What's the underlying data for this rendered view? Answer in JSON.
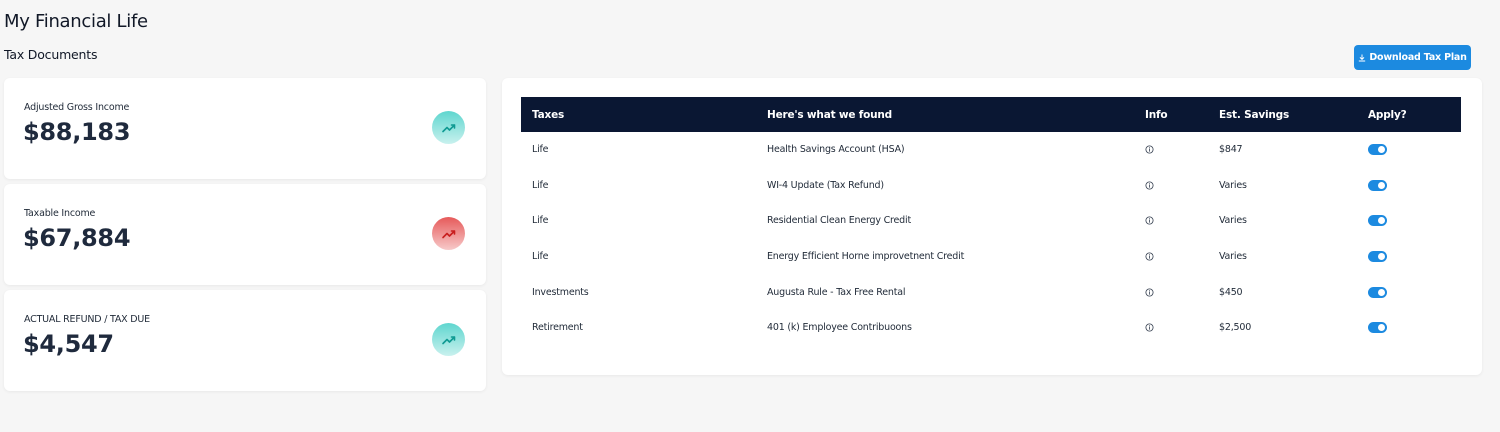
{
  "header": {
    "page_title": "My Financial Life",
    "section_title": "Tax Documents",
    "download_label": "Download Tax Plan"
  },
  "cards": [
    {
      "label": "Adjusted Gross Income",
      "value": "$88,183",
      "trend": "up",
      "icon": "trending-up-icon"
    },
    {
      "label": "Taxable Income",
      "value": "$67,884",
      "trend": "down",
      "icon": "trending-up-icon"
    },
    {
      "label": "ACTUAL REFUND / TAX DUE",
      "value": "$4,547",
      "trend": "up",
      "icon": "trending-up-icon"
    }
  ],
  "table": {
    "headers": [
      "Taxes",
      "Here's what we found",
      "Info",
      "Est. Savings",
      "Apply?"
    ],
    "rows": [
      {
        "tax": "Life",
        "found": "Health Savings Account (HSA)",
        "savings": "$847",
        "applied": true
      },
      {
        "tax": "Life",
        "found": "WI-4 Update (Tax Refund)",
        "savings": "Varies",
        "applied": true
      },
      {
        "tax": "Life",
        "found": "Residential Clean Energy Credit",
        "savings": "Varies",
        "applied": true
      },
      {
        "tax": "Life",
        "found": "Energy Efficient Horne improvetnent Credit",
        "savings": "Varies",
        "applied": true
      },
      {
        "tax": "Investments",
        "found": "Augusta Rule - Tax Free Rental",
        "savings": "$450",
        "applied": true
      },
      {
        "tax": "Retirement",
        "found": "401 (k) Employee Contribuoons",
        "savings": "$2,500",
        "applied": true
      }
    ]
  },
  "colors": {
    "accent": "#1c8ae0",
    "table_header": "#0a1733",
    "trend_up": "#18b6ad",
    "trend_down": "#d93a3a"
  }
}
